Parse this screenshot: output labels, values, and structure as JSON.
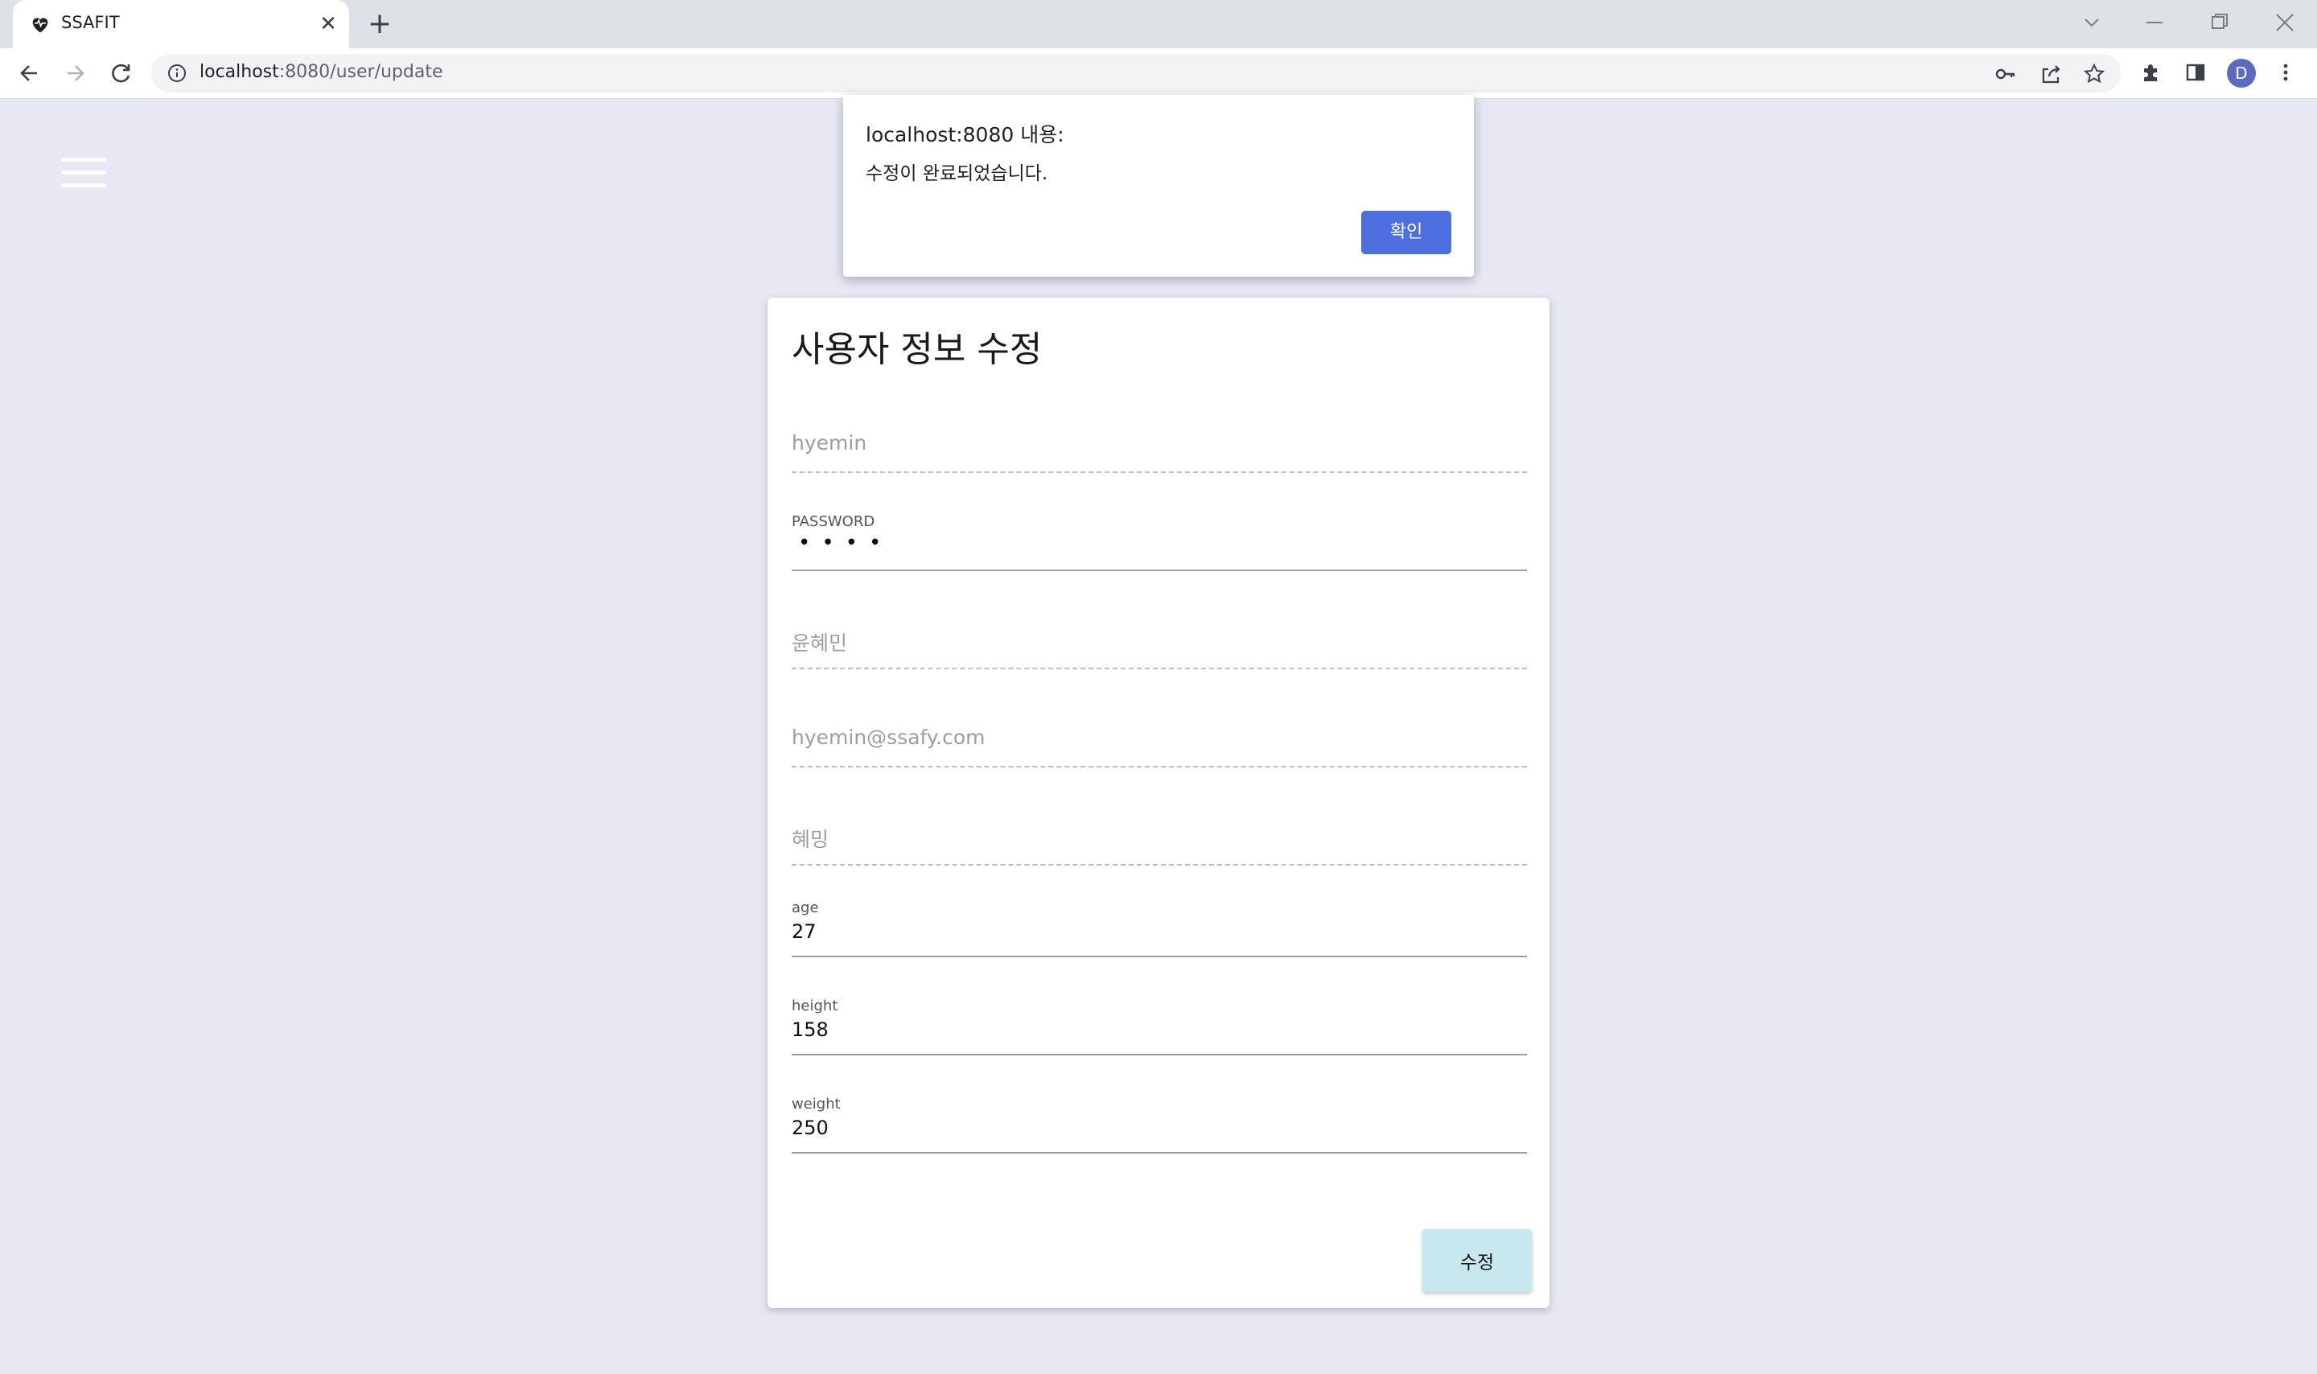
{
  "browser": {
    "tab_title": "SSAFIT",
    "url_host": "localhost",
    "url_rest": ":8080/user/update",
    "profile_initial": "D"
  },
  "dialog": {
    "title": "localhost:8080 내용:",
    "message": "수정이 완료되었습니다.",
    "ok_label": "확인",
    "ok_color": "#4e6fe0"
  },
  "form": {
    "title": "사용자 정보 수정",
    "fields": [
      {
        "placeholder": "hyemin"
      },
      {
        "label": "PASSWORD",
        "value": "••••"
      },
      {
        "placeholder": "윤혜민"
      },
      {
        "placeholder": "hyemin@ssafy.com"
      },
      {
        "placeholder": "혜밍"
      },
      {
        "label": "age",
        "value": "27"
      },
      {
        "label": "height",
        "value": "158"
      },
      {
        "label": "weight",
        "value": "250"
      }
    ],
    "submit_label": "수정"
  },
  "colors": {
    "page_background": "#e8e8f5",
    "submit_button": "#c8e8ef"
  }
}
